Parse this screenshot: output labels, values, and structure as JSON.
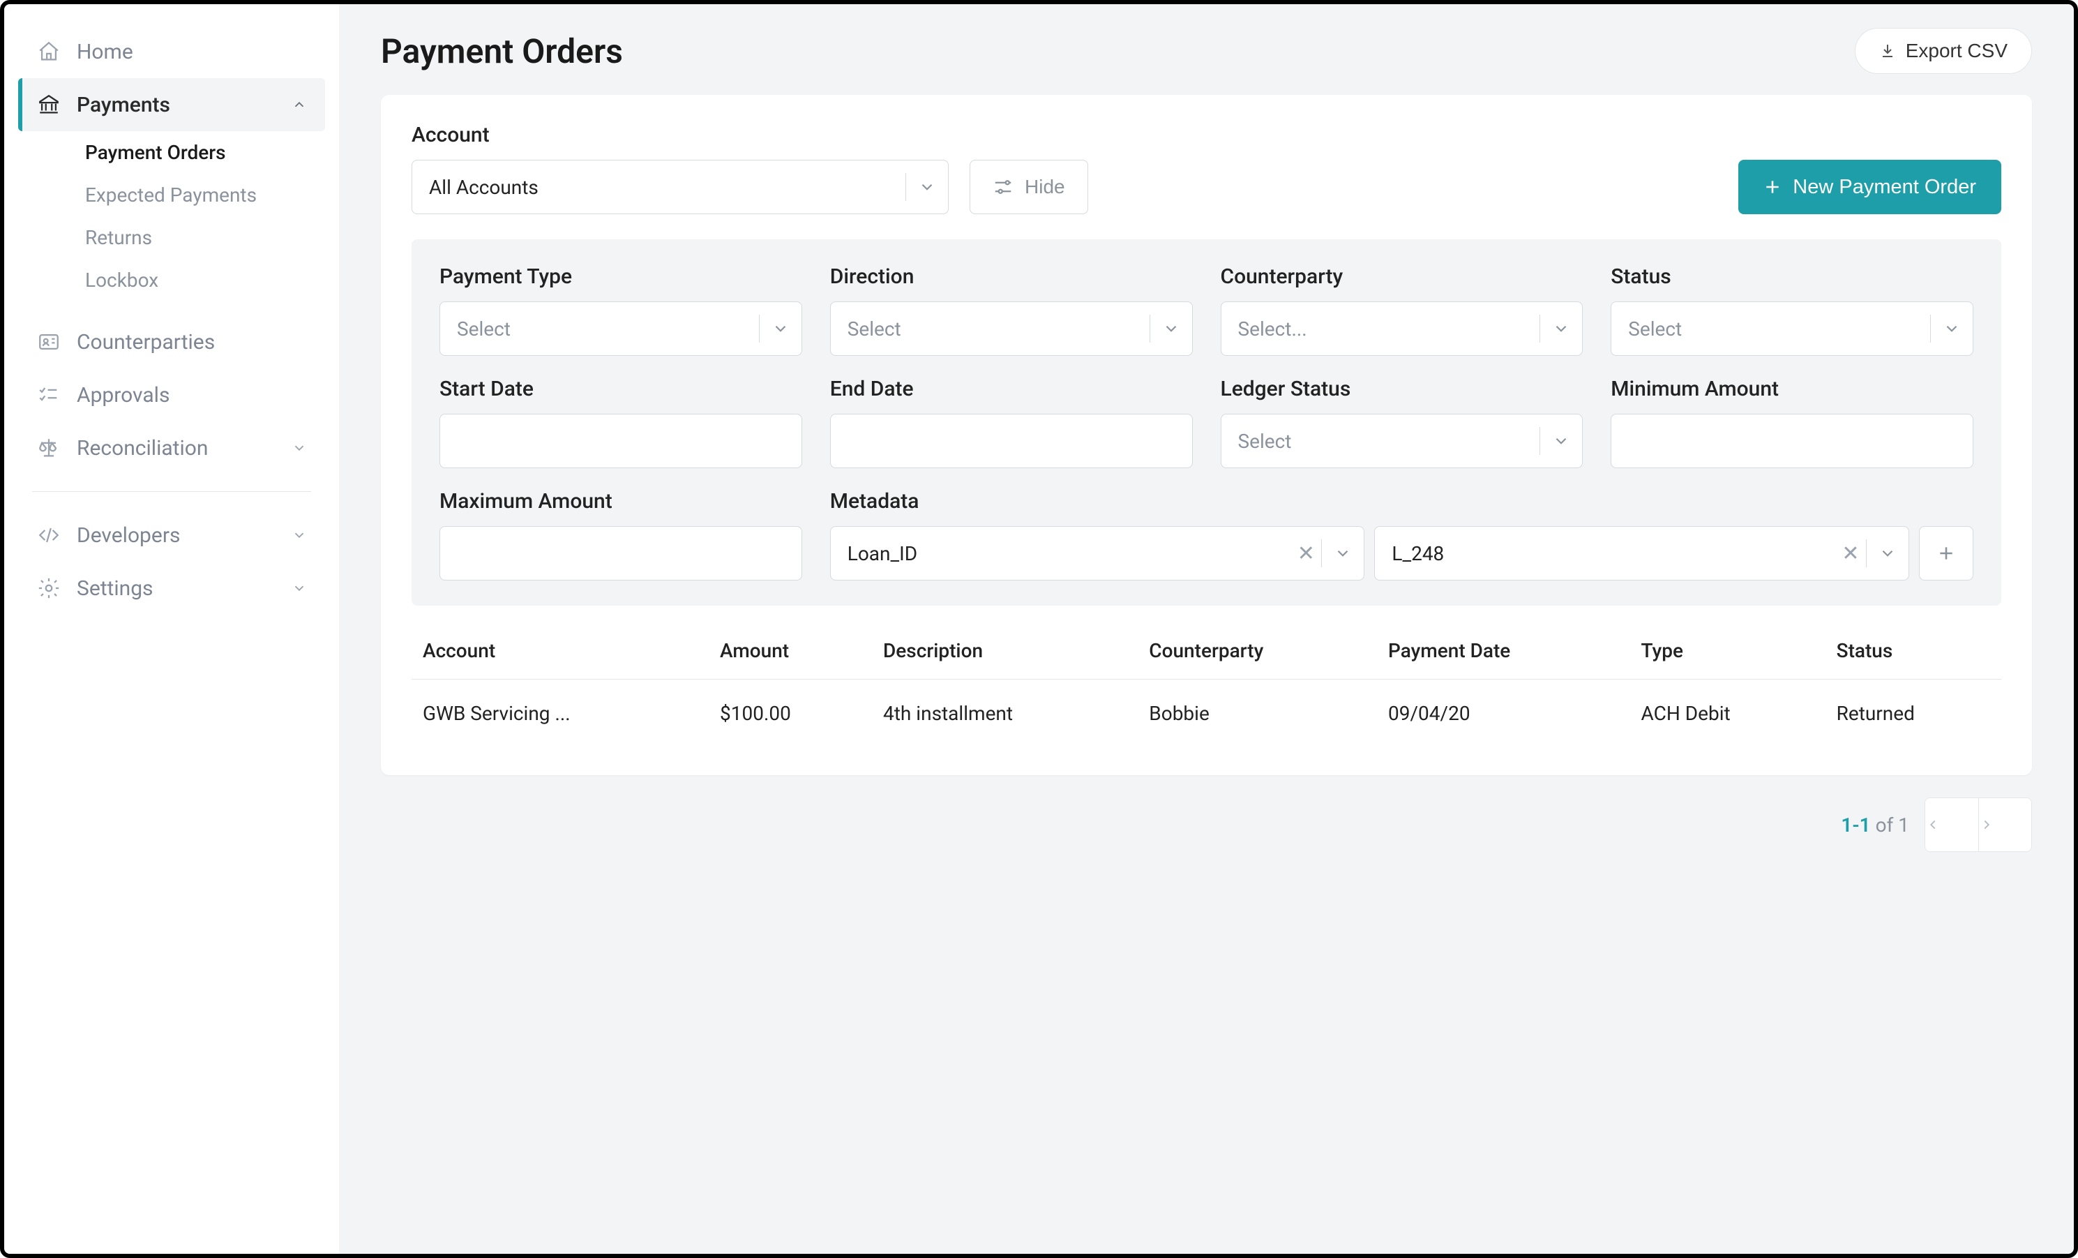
{
  "sidebar": {
    "items": [
      {
        "label": "Home"
      },
      {
        "label": "Payments"
      },
      {
        "label": "Counterparties"
      },
      {
        "label": "Approvals"
      },
      {
        "label": "Reconciliation"
      },
      {
        "label": "Developers"
      },
      {
        "label": "Settings"
      }
    ],
    "payments_sub": [
      {
        "label": "Payment Orders"
      },
      {
        "label": "Expected Payments"
      },
      {
        "label": "Returns"
      },
      {
        "label": "Lockbox"
      }
    ]
  },
  "header": {
    "title": "Payment Orders",
    "export_label": "Export CSV"
  },
  "filters": {
    "account_label": "Account",
    "account_value": "All Accounts",
    "hide_label": "Hide",
    "new_label": "New Payment Order",
    "panel": {
      "payment_type_label": "Payment Type",
      "payment_type_value": "Select",
      "direction_label": "Direction",
      "direction_value": "Select",
      "counterparty_label": "Counterparty",
      "counterparty_value": "Select...",
      "status_label": "Status",
      "status_value": "Select",
      "start_date_label": "Start Date",
      "end_date_label": "End Date",
      "ledger_status_label": "Ledger Status",
      "ledger_status_value": "Select",
      "min_amount_label": "Minimum Amount",
      "max_amount_label": "Maximum Amount",
      "metadata_label": "Metadata",
      "metadata_key": "Loan_ID",
      "metadata_value": "L_248"
    }
  },
  "table": {
    "columns": [
      "Account",
      "Amount",
      "Description",
      "Counterparty",
      "Payment Date",
      "Type",
      "Status"
    ],
    "rows": [
      {
        "account": "GWB Servicing ...",
        "amount": "$100.00",
        "description": "4th installment",
        "counterparty": "Bobbie",
        "payment_date": "09/04/20",
        "type": "ACH Debit",
        "status": "Returned"
      }
    ]
  },
  "pagination": {
    "range": "1-1",
    "of_text": " of ",
    "total": "1"
  }
}
